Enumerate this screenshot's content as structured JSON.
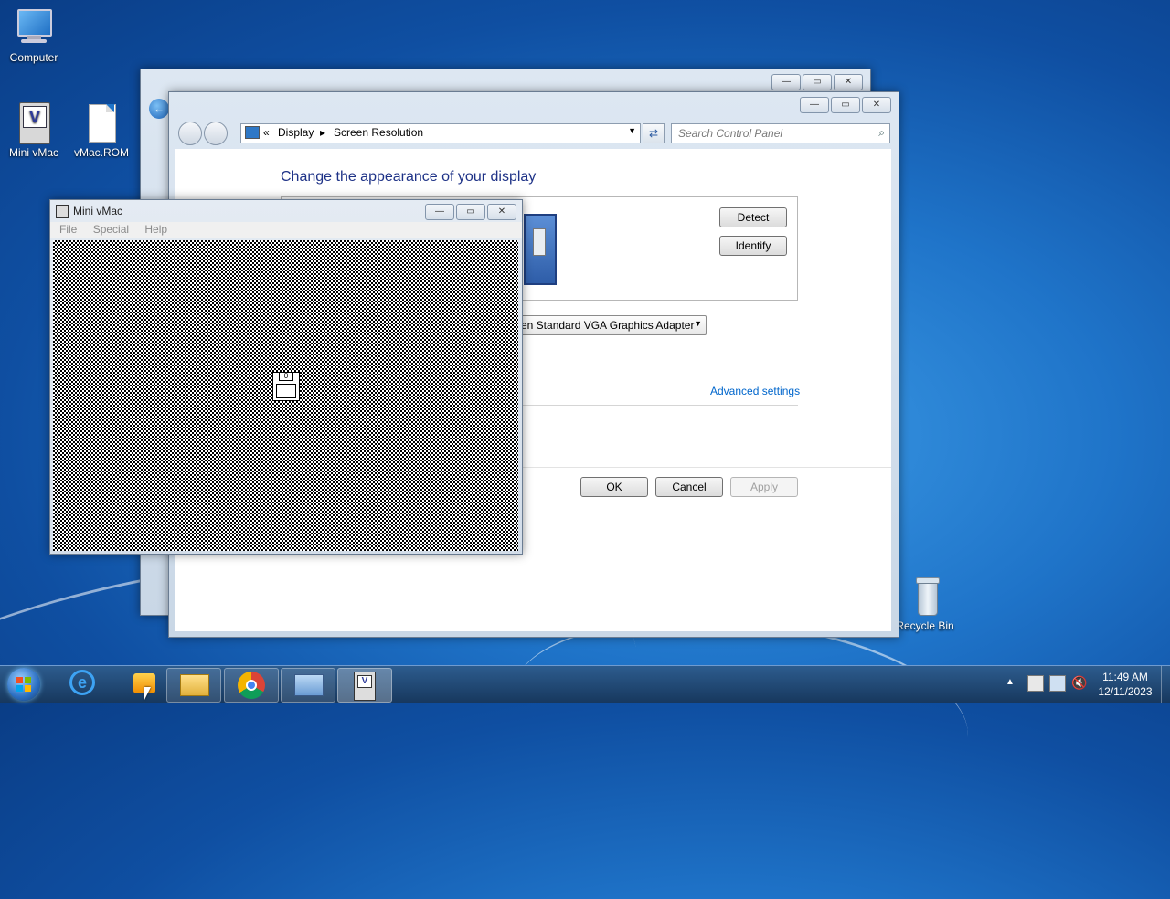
{
  "desktop": {
    "icons": [
      {
        "label": "Computer"
      },
      {
        "label": "Mini vMac"
      },
      {
        "label": "vMac.ROM"
      },
      {
        "label": "Recycle Bin"
      }
    ]
  },
  "screen_resolution": {
    "breadcrumb_chevrons": "«",
    "breadcrumb": [
      "Display",
      "Screen Resolution"
    ],
    "search_placeholder": "Search Control Panel",
    "heading": "Change the appearance of your display",
    "detect": "Detect",
    "identify": "Identify",
    "display_select": "en Standard VGA Graphics Adapter",
    "advanced": "Advanced settings",
    "ok": "OK",
    "cancel": "Cancel",
    "apply": "Apply"
  },
  "minivmac": {
    "title": "Mini vMac",
    "menu": [
      "File",
      "Special",
      "Help"
    ],
    "disk_label": "0"
  },
  "clock": {
    "time": "11:49 AM",
    "date": "12/11/2023"
  },
  "colors": {
    "link": "#0066cc",
    "heading": "#1e3287"
  }
}
